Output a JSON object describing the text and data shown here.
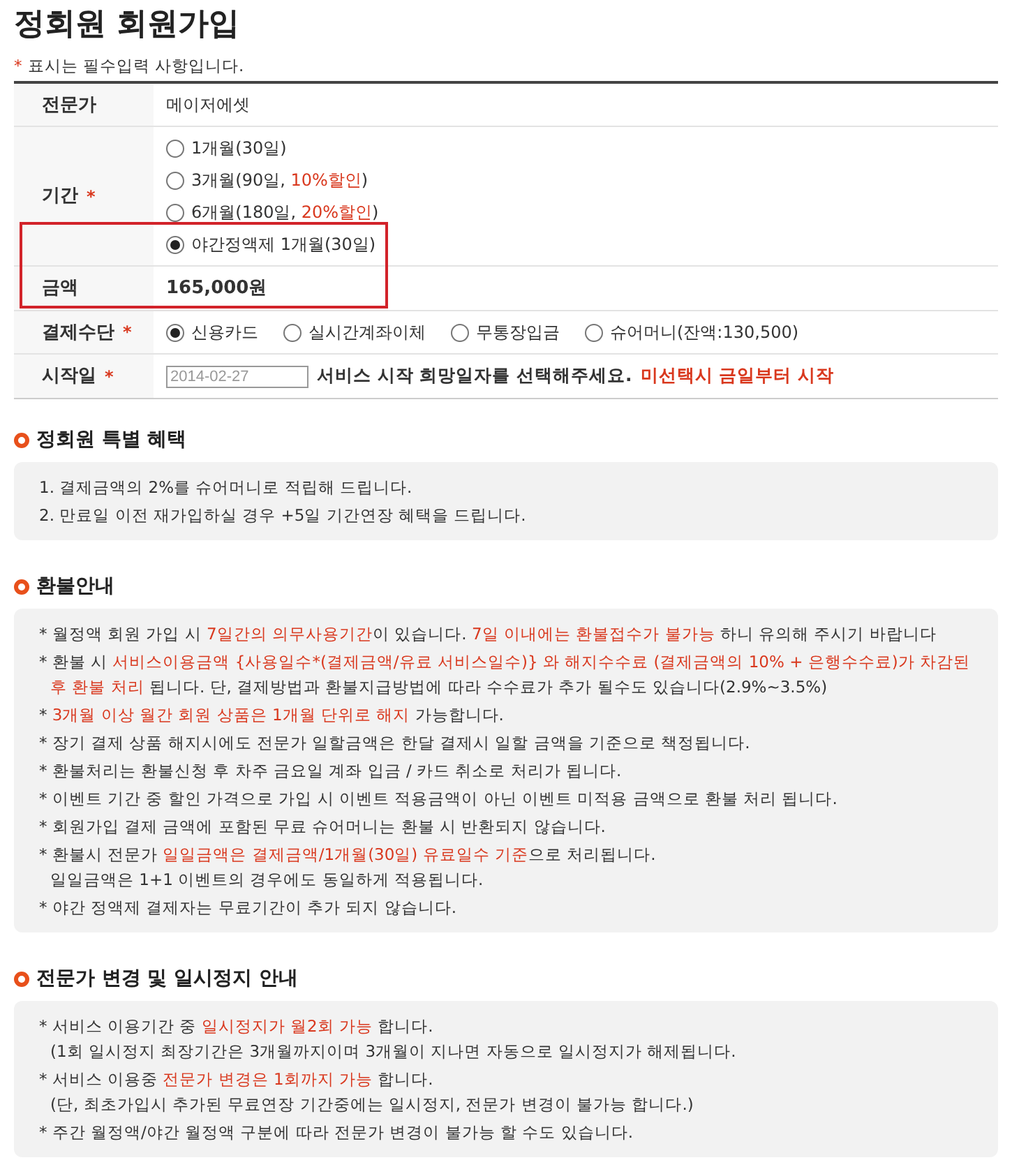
{
  "title": "정회원 회원가입",
  "required_note": {
    "mark": "*",
    "text": "표시는 필수입력 사항입니다."
  },
  "form": {
    "expert": {
      "label": "전문가",
      "value": "메이저에셋"
    },
    "period": {
      "label": "기간",
      "required_mark": "*",
      "options": [
        {
          "segments": [
            {
              "text": "1개월(30일)",
              "highlight": false
            }
          ],
          "selected": false
        },
        {
          "segments": [
            {
              "text": "3개월(90일, ",
              "highlight": false
            },
            {
              "text": "10%할인",
              "highlight": true
            },
            {
              "text": ")",
              "highlight": false
            }
          ],
          "selected": false
        },
        {
          "segments": [
            {
              "text": "6개월(180일, ",
              "highlight": false
            },
            {
              "text": "20%할인",
              "highlight": true
            },
            {
              "text": ")",
              "highlight": false
            }
          ],
          "selected": false
        },
        {
          "segments": [
            {
              "text": "야간정액제 1개월(30일)",
              "highlight": false
            }
          ],
          "selected": true
        }
      ]
    },
    "amount": {
      "label": "금액",
      "value": "165,000원"
    },
    "payment": {
      "label": "결제수단",
      "required_mark": "*",
      "options": [
        {
          "label": "신용카드",
          "selected": true
        },
        {
          "label": "실시간계좌이체",
          "selected": false
        },
        {
          "label": "무통장입금",
          "selected": false
        },
        {
          "label": "슈어머니(잔액:130,500)",
          "selected": false
        }
      ]
    },
    "start_date": {
      "label": "시작일",
      "required_mark": "*",
      "placeholder": "2014-02-27",
      "hint": "서비스 시작 희망일자를 선택해주세요.",
      "hint_note": "미선택시 금일부터 시작"
    },
    "annotation_frame": true
  },
  "sections": [
    {
      "title": "정회원 특별 혜택",
      "items": [
        {
          "lines": [
            [
              {
                "text": "1. 결제금액의 2%를 슈어머니로 적립해 드립니다.",
                "highlight": false
              }
            ]
          ]
        },
        {
          "lines": [
            [
              {
                "text": "2. 만료일 이전 재가입하실 경우 +5일 기간연장 혜택을 드립니다.",
                "highlight": false
              }
            ]
          ]
        }
      ]
    },
    {
      "title": "환불안내",
      "items": [
        {
          "lines": [
            [
              {
                "text": "* 월정액 회원 가입 시 ",
                "highlight": false
              },
              {
                "text": "7일간의 의무사용기간",
                "highlight": true
              },
              {
                "text": "이 있습니다. ",
                "highlight": false
              },
              {
                "text": "7일 이내에는 환불접수가 불가능",
                "highlight": true
              },
              {
                "text": " 하니 유의해 주시기 바랍니다",
                "highlight": false
              }
            ]
          ]
        },
        {
          "lines": [
            [
              {
                "text": "* 환불 시 ",
                "highlight": false
              },
              {
                "text": "서비스이용금액 {사용일수*(결제금액/유료 서비스일수)} 와 해지수수료 (결제금액의 10% + 은행수수료)가 차감된 후 환불 처리",
                "highlight": true
              },
              {
                "text": " 됩니다. 단, 결제방법과 환불지급방법에 따라 수수료가 추가 될수도 있습니다(2.9%~3.5%)",
                "highlight": false
              }
            ]
          ]
        },
        {
          "lines": [
            [
              {
                "text": "*  ",
                "highlight": false
              },
              {
                "text": "3개월 이상 월간 회원 상품은 1개월 단위로 해지",
                "highlight": true
              },
              {
                "text": " 가능합니다.",
                "highlight": false
              }
            ]
          ]
        },
        {
          "lines": [
            [
              {
                "text": "* 장기 결제 상품 해지시에도 전문가 일할금액은 한달 결제시 일할 금액을 기준으로 책정됩니다.",
                "highlight": false
              }
            ]
          ]
        },
        {
          "lines": [
            [
              {
                "text": "* 환불처리는 환불신청 후 차주 금요일 계좌 입금 / 카드 취소로 처리가 됩니다.",
                "highlight": false
              }
            ]
          ]
        },
        {
          "lines": [
            [
              {
                "text": "* 이벤트 기간 중 할인 가격으로 가입 시 이벤트 적용금액이 아닌 이벤트 미적용 금액으로 환불 처리 됩니다.",
                "highlight": false
              }
            ]
          ]
        },
        {
          "lines": [
            [
              {
                "text": "* 회원가입 결제 금액에 포함된 무료 슈어머니는 환불 시 반환되지 않습니다.",
                "highlight": false
              }
            ]
          ]
        },
        {
          "lines": [
            [
              {
                "text": "* 환불시 전문가 ",
                "highlight": false
              },
              {
                "text": "일일금액은 결제금액/1개월(30일) 유료일수 기준",
                "highlight": true
              },
              {
                "text": "으로 처리됩니다.",
                "highlight": false
              }
            ],
            [
              {
                "text": "일일금액은 1+1 이벤트의 경우에도 동일하게 적용됩니다.",
                "highlight": false
              }
            ]
          ]
        },
        {
          "lines": [
            [
              {
                "text": "* 야간 정액제 결제자는 무료기간이 추가 되지 않습니다.",
                "highlight": false
              }
            ]
          ]
        }
      ]
    },
    {
      "title": "전문가 변경 및 일시정지 안내",
      "items": [
        {
          "lines": [
            [
              {
                "text": "* 서비스 이용기간 중 ",
                "highlight": false
              },
              {
                "text": "일시정지가 월2회 가능",
                "highlight": true
              },
              {
                "text": " 합니다.",
                "highlight": false
              }
            ],
            [
              {
                "text": "(1회 일시정지 최장기간은 3개월까지이며 3개월이 지나면 자동으로 일시정지가 해제됩니다.",
                "highlight": false
              }
            ]
          ]
        },
        {
          "lines": [
            [
              {
                "text": "* 서비스 이용중 ",
                "highlight": false
              },
              {
                "text": "전문가 변경은 1회까지 가능",
                "highlight": true
              },
              {
                "text": " 합니다.",
                "highlight": false
              }
            ],
            [
              {
                "text": "(단, 최초가입시 추가된 무료연장 기간중에는 일시정지, 전문가 변경이 불가능 합니다.)",
                "highlight": false
              }
            ]
          ]
        },
        {
          "lines": [
            [
              {
                "text": "* 주간 월정액/야간 월정액 구분에 따라 전문가 변경이 불가능 할 수도 있습니다.",
                "highlight": false
              }
            ]
          ]
        }
      ]
    }
  ]
}
